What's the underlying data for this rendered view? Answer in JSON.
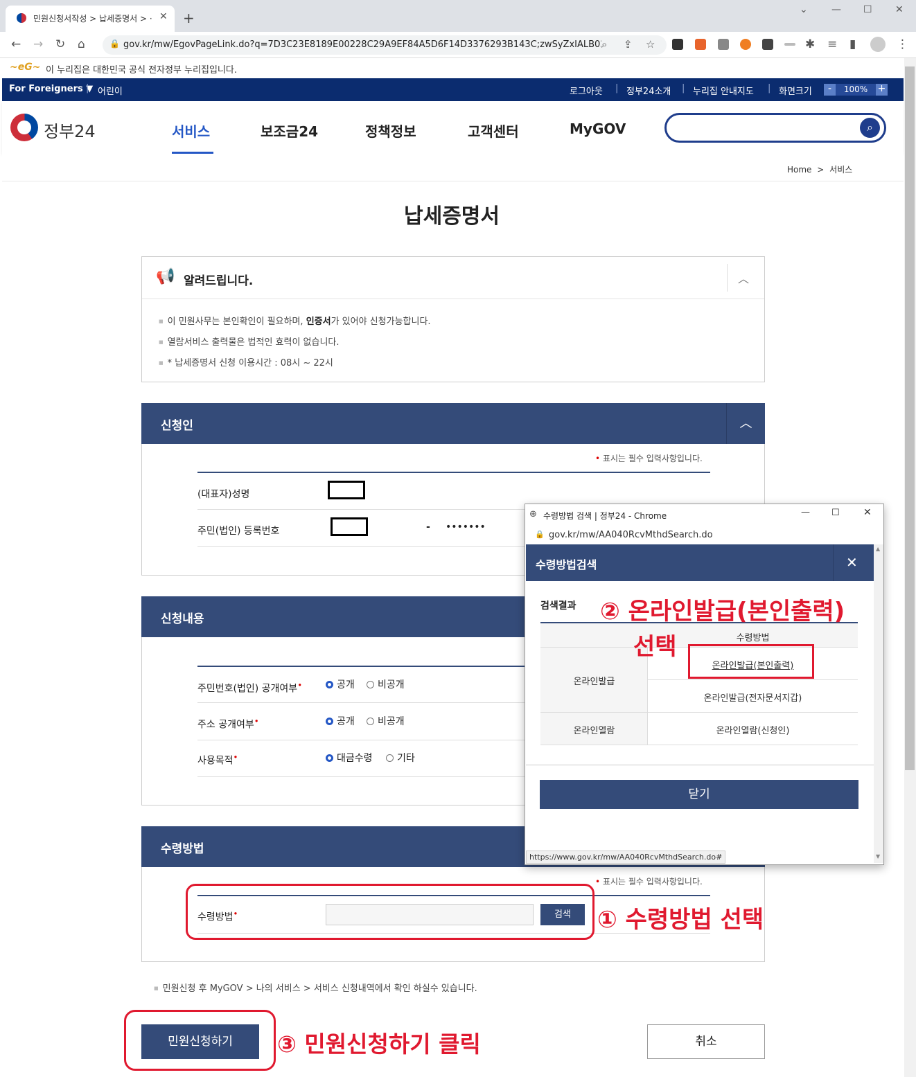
{
  "browser": {
    "tab_title": "민원신청서작성 > 납세증명서 > ·",
    "url": "gov.kr/mw/EgovPageLink.do?q=7D3C23E8189E00228C29A9EF84A5D6F14D3376293B143C;zwSyZxIALB02..."
  },
  "gov_banner": {
    "text": "이 누리집은 대한민국 공식 전자정부 누리집입니다."
  },
  "topnav": {
    "foreigners": "For Foreigners ▼",
    "kids": "어린이",
    "logout": "로그아웃",
    "about": "정부24소개",
    "sitemap": "누리집 안내지도",
    "screen_size": "화면크기",
    "zoom_minus": "-",
    "zoom_value": "100%",
    "zoom_plus": "+"
  },
  "header": {
    "logo": "정부24",
    "menu": [
      "서비스",
      "보조금24",
      "정책정보",
      "고객센터",
      "MyGOV"
    ]
  },
  "breadcrumb": {
    "home": "Home",
    "sep": ">",
    "current": "서비스"
  },
  "page_title": "납세증명서",
  "notice": {
    "title": "알려드립니다.",
    "items_a_pre": "이 민원사무는 본인확인이 필요하며, ",
    "items_a_bold": "인증서",
    "items_a_post": "가 있어야 신청가능합니다.",
    "item_b": "열람서비스 출력물은 법적인 효력이 없습니다.",
    "item_c": "* 납세증명서 신청 이용시간 : 08시 ~ 22시"
  },
  "applicant": {
    "title": "신청인",
    "required_note": "표시는 필수 입력사항입니다.",
    "name_label": "(대표자)성명",
    "rrn_label": "주민(법인) 등록번호",
    "rrn_dash": "-",
    "rrn_mask": "•••••••"
  },
  "content": {
    "title": "신청내용",
    "rrn_public_label": "주민번호(법인) 공개여부",
    "addr_public_label": "주소 공개여부",
    "purpose_label": "사용목적",
    "opt_public": "공개",
    "opt_private": "비공개",
    "opt_payment": "대금수령",
    "opt_other": "기타"
  },
  "receive": {
    "title": "수령방법",
    "required_note": "표시는 필수 입력사항입니다.",
    "label": "수령방법",
    "search_button": "검색"
  },
  "footer_note": "민원신청 후 MyGOV > 나의 서비스 > 서비스 신청내역에서 확인 하실수 있습니다.",
  "buttons": {
    "submit": "민원신청하기",
    "cancel": "취소"
  },
  "annotations": {
    "step1": "① 수령방법 선택",
    "step2": "② 온라인발급(본인출력)",
    "step2b": "선택",
    "step3": "③ 민원신청하기 클릭"
  },
  "popup": {
    "window_title": "수령방법 검색 | 정부24 - Chrome",
    "url": "gov.kr/mw/AA040RcvMthdSearch.do",
    "header": "수령방법검색",
    "close_x": "✕",
    "results_label": "검색결과",
    "col_header": "수령방법",
    "group1": "온라인발급",
    "opt1": "온라인발급(본인출력)",
    "opt2": "온라인발급(전자문서지갑)",
    "group2": "온라인열람",
    "opt3": "온라인열람(신청인)",
    "close_button": "닫기",
    "status_url": "https://www.gov.kr/mw/AA040RcvMthdSearch.do#"
  },
  "colors": {
    "navy": "#344b79",
    "accent": "#2457c5",
    "annotation_red": "#e0192f"
  }
}
